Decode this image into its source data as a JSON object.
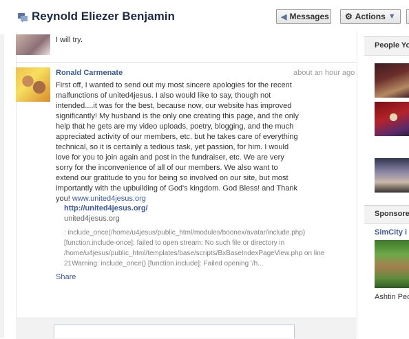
{
  "header": {
    "title": "Reynold Eliezer Benjamin",
    "messages_label": "Messages",
    "actions_label": "Actions"
  },
  "previous_message": {
    "text": "I will try."
  },
  "message": {
    "sender": "Ronald Carmenate",
    "timestamp": "about an hour ago",
    "body": "First off, I wanted to send out my most sincere apologies for the recent malfunctions of united4jesus. I also would like to say, though not intended....it was for the best, because now, our website has improved significantly! My husband is the only one creating this page, and the only help that he gets are my video uploads, poetry, blogging, and the much appreciated activity of our members, etc. but he takes care of everything technical, so it is certainly a tedious task, yet passion, for him. I would love for you to join again and post in the fundraiser, etc. We are very sorry for the inconvenience of all of our members. We also want to extend our gratitude to you for being so involved on our site, but most importantly with the upbuilding of God's kingdom. God Bless! and Thank you!",
    "body_link": "www.united4jesus.org",
    "attachment": {
      "title": "http://united4jesus.org/",
      "domain": "united4jesus.org",
      "description": ": include_once(/home/u4jesus/public_html/modules/boonex/avatar/include.php) [function.include-once]: failed to open stream: No such file or directory in /home/u4jesus/public_html/templates/base/scripts/BxBaseIndexPageView.php on line 21Warning: include_once() [function.include]: Failed opening '/h..."
    },
    "share_label": "Share"
  },
  "sidebar": {
    "people_heading": "People Yo",
    "sponsored_heading": "Sponsore",
    "sponsor_title": "SimCity i",
    "sponsor_text": "Ashtin Ped"
  },
  "icons": {
    "title_icon": "messages-icon",
    "actions_icon": "gear-icon",
    "actions_chevron": "chevron-down-icon",
    "messages_arrow": "back-arrow-icon"
  },
  "colors": {
    "link": "#3b5998",
    "title": "#1c2a47"
  }
}
